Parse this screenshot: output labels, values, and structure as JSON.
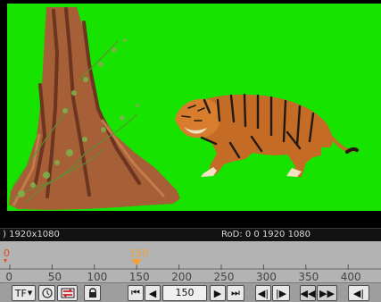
{
  "viewer": {
    "info_left": ") 1920x1080",
    "info_right": "RoD: 0 0 1920 1080"
  },
  "timeline": {
    "ticks": [
      "0",
      "50",
      "100",
      "150",
      "200",
      "250",
      "300",
      "350",
      "400"
    ],
    "current_frame_marker": "150",
    "start_marker": "0"
  },
  "controls": {
    "tf_label": "TF",
    "current_frame": "150"
  },
  "colors": {
    "chroma_green": "#16e400",
    "playhead": "#f2a030",
    "start_marker": "#e24a1a"
  },
  "icons": [
    "turbo-dropdown-icon",
    "clock-icon",
    "loop-icon",
    "lock-icon",
    "first-frame-icon",
    "previous-frame-icon",
    "next-frame-icon",
    "last-frame-icon",
    "previous-keyframe-icon",
    "next-keyframe-icon",
    "rewind-icon",
    "fast-forward-icon",
    "play-backward-icon"
  ]
}
